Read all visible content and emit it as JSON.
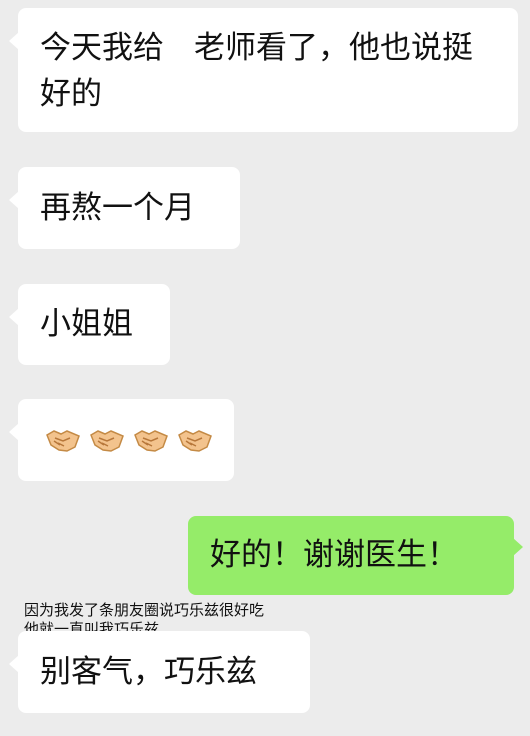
{
  "messages": [
    {
      "direction": "incoming",
      "text_before": "今天我给",
      "text_after": "老师看了，他也说挺好的"
    },
    {
      "direction": "incoming",
      "text": "再熬一个月"
    },
    {
      "direction": "incoming",
      "text": "小姐姐"
    },
    {
      "direction": "incoming",
      "emoji": "handshake-icon",
      "emoji_count": 4
    },
    {
      "direction": "outgoing",
      "text": "好的！谢谢医生！"
    },
    {
      "direction": "incoming",
      "text": "别客气，巧乐兹"
    }
  ],
  "caption": "因为我发了条朋友圈说巧乐兹很好吃\n他就一直叫我巧乐兹",
  "colors": {
    "background": "#ececec",
    "incoming_bubble": "#ffffff",
    "outgoing_bubble": "#95ec69",
    "text": "#111111"
  }
}
